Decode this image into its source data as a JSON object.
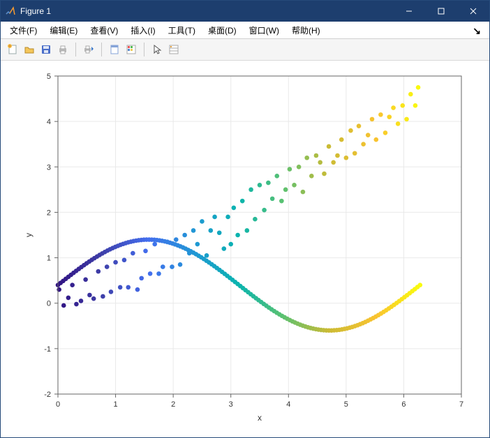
{
  "colors": {
    "titlebar_bg": "#1d3e6e"
  },
  "window": {
    "title": "Figure 1"
  },
  "menu": {
    "items": [
      {
        "label": "文件(F)"
      },
      {
        "label": "编辑(E)"
      },
      {
        "label": "查看(V)"
      },
      {
        "label": "插入(I)"
      },
      {
        "label": "工具(T)"
      },
      {
        "label": "桌面(D)"
      },
      {
        "label": "窗口(W)"
      },
      {
        "label": "帮助(H)"
      }
    ],
    "more": "↘"
  },
  "toolbar": {
    "icons": [
      "new-figure-icon",
      "open-icon",
      "save-icon",
      "print-icon",
      "|",
      "print-preview-icon",
      "|",
      "link-icon",
      "colorbar-icon",
      "|",
      "pointer-icon",
      "properties-icon"
    ]
  },
  "chart_data": {
    "type": "scatter",
    "xlabel": "x",
    "ylabel": "y",
    "xlim": [
      0,
      7
    ],
    "ylim": [
      -2,
      5
    ],
    "xticks": [
      0,
      1,
      2,
      3,
      4,
      5,
      6,
      7
    ],
    "yticks": [
      -2,
      -1,
      0,
      1,
      2,
      3,
      4,
      5
    ],
    "grid": true,
    "colormap": "parula",
    "series": [
      {
        "name": "sine_curve",
        "description": "Dense points along y = sin(x) + 0.4 for x in [0, 2π], colored by x value",
        "x_start": 0.0,
        "x_end": 6.2832,
        "n_points": 140,
        "formula": "sin(x) + 0.4",
        "color_by": "x"
      },
      {
        "name": "noisy_linear",
        "description": "Scattered points roughly following y = 0.76*x with noise, colored by x value",
        "points": [
          [
            0.02,
            0.3
          ],
          [
            0.1,
            -0.05
          ],
          [
            0.18,
            0.12
          ],
          [
            0.25,
            0.4
          ],
          [
            0.32,
            -0.02
          ],
          [
            0.4,
            0.05
          ],
          [
            0.48,
            0.52
          ],
          [
            0.55,
            0.18
          ],
          [
            0.62,
            0.1
          ],
          [
            0.7,
            0.7
          ],
          [
            0.78,
            0.15
          ],
          [
            0.85,
            0.8
          ],
          [
            0.92,
            0.25
          ],
          [
            1.0,
            0.9
          ],
          [
            1.08,
            0.35
          ],
          [
            1.15,
            0.95
          ],
          [
            1.22,
            0.35
          ],
          [
            1.3,
            1.1
          ],
          [
            1.38,
            0.3
          ],
          [
            1.45,
            0.55
          ],
          [
            1.52,
            1.15
          ],
          [
            1.6,
            0.65
          ],
          [
            1.68,
            1.3
          ],
          [
            1.75,
            0.65
          ],
          [
            1.82,
            0.8
          ],
          [
            1.9,
            1.35
          ],
          [
            1.98,
            0.8
          ],
          [
            2.05,
            1.4
          ],
          [
            2.12,
            0.85
          ],
          [
            2.2,
            1.5
          ],
          [
            2.28,
            1.1
          ],
          [
            2.35,
            1.6
          ],
          [
            2.42,
            1.3
          ],
          [
            2.5,
            1.8
          ],
          [
            2.58,
            1.05
          ],
          [
            2.65,
            1.6
          ],
          [
            2.72,
            1.9
          ],
          [
            2.8,
            1.55
          ],
          [
            2.88,
            1.2
          ],
          [
            2.95,
            1.9
          ],
          [
            3.0,
            1.3
          ],
          [
            3.05,
            2.1
          ],
          [
            3.12,
            1.5
          ],
          [
            3.2,
            2.25
          ],
          [
            3.28,
            1.6
          ],
          [
            3.35,
            2.5
          ],
          [
            3.42,
            1.85
          ],
          [
            3.5,
            2.6
          ],
          [
            3.58,
            2.05
          ],
          [
            3.65,
            2.65
          ],
          [
            3.72,
            2.3
          ],
          [
            3.8,
            2.8
          ],
          [
            3.88,
            2.25
          ],
          [
            3.95,
            2.5
          ],
          [
            4.02,
            2.95
          ],
          [
            4.1,
            2.6
          ],
          [
            4.18,
            3.0
          ],
          [
            4.25,
            2.45
          ],
          [
            4.32,
            3.2
          ],
          [
            4.4,
            2.8
          ],
          [
            4.48,
            3.25
          ],
          [
            4.55,
            3.1
          ],
          [
            4.62,
            2.85
          ],
          [
            4.7,
            3.45
          ],
          [
            4.78,
            3.1
          ],
          [
            4.85,
            3.25
          ],
          [
            4.92,
            3.6
          ],
          [
            5.0,
            3.2
          ],
          [
            5.08,
            3.8
          ],
          [
            5.15,
            3.3
          ],
          [
            5.22,
            3.9
          ],
          [
            5.3,
            3.5
          ],
          [
            5.38,
            3.7
          ],
          [
            5.45,
            4.05
          ],
          [
            5.52,
            3.6
          ],
          [
            5.6,
            4.15
          ],
          [
            5.68,
            3.75
          ],
          [
            5.75,
            4.1
          ],
          [
            5.82,
            4.3
          ],
          [
            5.9,
            3.95
          ],
          [
            5.98,
            4.35
          ],
          [
            6.05,
            4.05
          ],
          [
            6.12,
            4.6
          ],
          [
            6.2,
            4.35
          ],
          [
            6.25,
            4.75
          ]
        ],
        "color_by": "x"
      }
    ]
  }
}
